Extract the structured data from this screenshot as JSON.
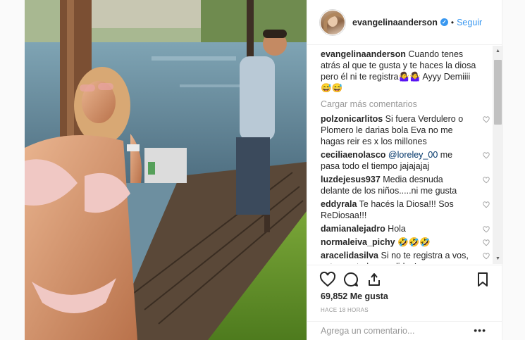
{
  "post": {
    "username": "evangelinaanderson",
    "verified_badge": "✓",
    "separator": "•",
    "follow_label": "Seguir"
  },
  "caption": {
    "username": "evangelinaanderson",
    "text": " Cuando tenes atrás al que te gusta y te haces la diosa pero él ni te registra🤷‍♀️🤷‍♀️ Ayyy Demiiii 😅😅"
  },
  "load_more_label": "Cargar más comentarios",
  "comments": [
    {
      "user": "polzonicarlitos",
      "text": " Si fuera Verdulero o Plomero le darias bola Eva no me hagas reir es x los millones",
      "mention": ""
    },
    {
      "user": "ceciliaenolasco",
      "text": " me pasa todo el tiempo jajajajaj",
      "mention": "@loreley_00"
    },
    {
      "user": "luzdejesus937",
      "text": " Media desnuda delante de los niños.....ni me gusta",
      "mention": ""
    },
    {
      "user": "eddyrala",
      "text": " Te hacés la Diosa!!! Sos ReDiosaa!!!",
      "mention": ""
    },
    {
      "user": "damianalejadro",
      "text": " Hola",
      "mention": ""
    },
    {
      "user": "normaleiva_pichy",
      "text": " 🤣🤣🤣",
      "mention": ""
    },
    {
      "user": "aracelidasilva",
      "text": " Si no te registra a vos, estamos todas perdidas!",
      "mention": ""
    }
  ],
  "likes": "69,852 Me gusta",
  "timestamp": "HACE 18 HORAS",
  "add_comment": {
    "placeholder": "Agrega un comentario..."
  },
  "more_label": "•••",
  "icons": {
    "like": "heart-icon",
    "comment": "comment-icon",
    "share": "share-icon",
    "save": "bookmark-icon"
  },
  "colors": {
    "link": "#3897f0",
    "text": "#262626",
    "muted": "#999999"
  }
}
